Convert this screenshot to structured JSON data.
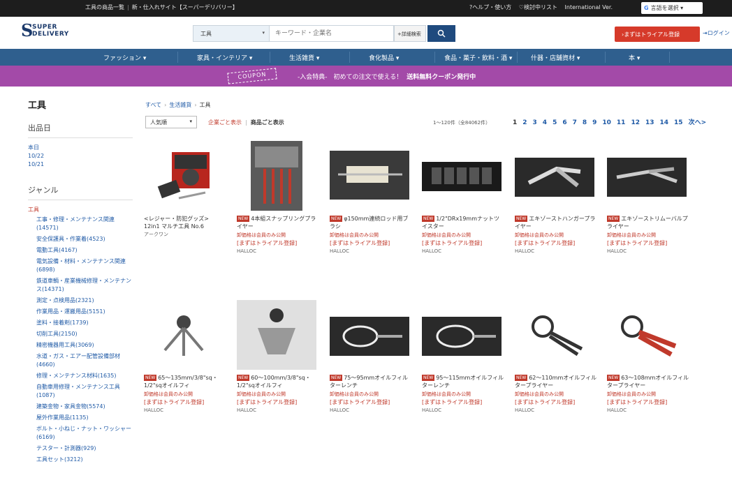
{
  "topbar": {
    "left_links": [
      "工具の商品一覧",
      "新・仕入れサイト【スーパーデリバリー】"
    ],
    "right_links": [
      "?ヘルプ・使い方",
      "♡検討中リスト",
      "International Ver."
    ],
    "language_label": "言語を選択"
  },
  "header": {
    "logo_line1": "SUPER",
    "logo_line2": "DELIVERY",
    "search_category": "工具",
    "search_placeholder": "キーワード・企業名",
    "advanced_search": "+詳細検索",
    "trial_button": "›まずはトライアル登録",
    "login": "ログイン"
  },
  "nav": {
    "items": [
      "ファッション ▾",
      "家具・インテリア ▾",
      "生活雑貨 ▾",
      "食化製品 ▾",
      "食品・菓子・飲料・酒 ▾",
      "什器・店舗資材 ▾",
      "本 ▾"
    ]
  },
  "coupon": {
    "ticket": "COUPON",
    "text": "-入会特典-　初めての注文で使える！",
    "bold": "送料無料クーポン発行中"
  },
  "sidebar": {
    "title": "工具",
    "date_heading": "出品日",
    "dates": [
      "本日",
      "10/22",
      "10/21"
    ],
    "genre_heading": "ジャンル",
    "genre_root": "工具",
    "genres": [
      "工事・修理・メンテナンス関連(14571)",
      "安全保護具・作業着(4523)",
      "電動工具(4167)",
      "電気設備・材料・メンテナンス関連(6898)",
      "鉄道車輌・産業機械修理・メンテナンス(14371)",
      "測定・点検用品(2321)",
      "作業用品・運搬用品(5151)",
      "塗料・接着剤(1739)",
      "切削工具(2150)",
      "精密機器用工具(3069)",
      "水道・ガス・エアー配管設備部材(4660)",
      "修理・メンテナンス材料(1635)",
      "自動車用修理・メンテナンス工具(1087)",
      "建築金物・家具金物(5574)",
      "屋外作業用品(1135)",
      "ボルト・小ねじ・ナット・ワッシャー(6169)",
      "テスター・計測器(929)",
      "工具セット(3212)"
    ]
  },
  "main": {
    "breadcrumb": [
      "すべて",
      "生活雑貨",
      "工具"
    ],
    "sort": "人気順",
    "view_company": "企業ごと表示",
    "view_product": "商品ごと表示",
    "count": "1～120件（全84062件）",
    "pages": [
      "1",
      "2",
      "3",
      "4",
      "5",
      "6",
      "7",
      "8",
      "9",
      "10",
      "11",
      "12",
      "13",
      "14",
      "15",
      "次へ>"
    ]
  },
  "products": [
    {
      "new": false,
      "title": "<レジャー・防犯グッズ> 12in1 マルチ工具 No.6",
      "price": "",
      "trial": "",
      "shop": "アークワン"
    },
    {
      "new": true,
      "title": "4本組スナップリングプライヤー",
      "price": "卸価格は会員のみ公開",
      "trial": "[まずはトライアル登録]",
      "shop": "HALLOC"
    },
    {
      "new": true,
      "title": "φ150mm連続ロッド用ブラシ",
      "price": "卸価格は会員のみ公開",
      "trial": "[まずはトライアル登録]",
      "shop": "HALLOC"
    },
    {
      "new": true,
      "title": "1/2\"DRx19mmナットツイスター",
      "price": "卸価格は会員のみ公開",
      "trial": "[まずはトライアル登録]",
      "shop": "HALLOC"
    },
    {
      "new": true,
      "title": "エキゾーストハンガープライヤー",
      "price": "卸価格は会員のみ公開",
      "trial": "[まずはトライアル登録]",
      "shop": "HALLOC"
    },
    {
      "new": true,
      "title": "エキゾーストリムーバルプライヤー",
      "price": "卸価格は会員のみ公開",
      "trial": "[まずはトライアル登録]",
      "shop": "HALLOC"
    },
    {
      "new": true,
      "title": "65～135mm/3/8\"sq・1/2\"sqオイルフィ",
      "price": "卸価格は会員のみ公開",
      "trial": "[まずはトライアル登録]",
      "shop": "HALLOC"
    },
    {
      "new": true,
      "title": "60～100mm/3/8\"sq・1/2\"sqオイルフィ",
      "price": "卸価格は会員のみ公開",
      "trial": "[まずはトライアル登録]",
      "shop": "HALLOC"
    },
    {
      "new": true,
      "title": "75～95mmオイルフィルターレンチ",
      "price": "卸価格は会員のみ公開",
      "trial": "[まずはトライアル登録]",
      "shop": "HALLOC"
    },
    {
      "new": true,
      "title": "95～115mmオイルフィルターレンチ",
      "price": "卸価格は会員のみ公開",
      "trial": "[まずはトライアル登録]",
      "shop": "HALLOC"
    },
    {
      "new": true,
      "title": "62～110mmオイルフィルタープライヤー",
      "price": "卸価格は会員のみ公開",
      "trial": "[まずはトライアル登録]",
      "shop": "HALLOC"
    },
    {
      "new": true,
      "title": "63～108mmオイルフィルタープライヤー",
      "price": "卸価格は会員のみ公開",
      "trial": "[まずはトライアル登録]",
      "shop": "HALLOC"
    }
  ],
  "badge_new": "NEW",
  "colors": {
    "nav": "#2f5f8e",
    "coupon": "#a34aa8",
    "trial": "#d63a2a",
    "link": "#1f5aa6",
    "accent_red": "#c0392b"
  }
}
